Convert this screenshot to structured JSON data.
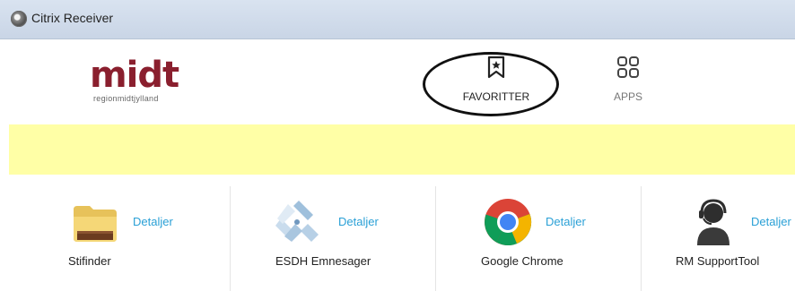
{
  "window": {
    "title": "Citrix Receiver"
  },
  "header": {
    "logo_text": "midt",
    "logo_subtext": "regionmidtjylland",
    "tabs": [
      {
        "label": "FAVORITTER",
        "icon": "bookmark-star-icon",
        "selected": true
      },
      {
        "label": "APPS",
        "icon": "apps-grid-icon",
        "selected": false
      }
    ]
  },
  "banner": {
    "color": "#ffffa6"
  },
  "apps": [
    {
      "name": "Stifinder",
      "details_label": "Detaljer",
      "icon": "folder-icon"
    },
    {
      "name": "ESDH Emnesager",
      "details_label": "Detaljer",
      "icon": "esdh-icon"
    },
    {
      "name": "Google Chrome",
      "details_label": "Detaljer",
      "icon": "chrome-icon"
    },
    {
      "name": "RM SupportTool",
      "details_label": "Detaljer",
      "icon": "support-person-icon"
    }
  ],
  "colors": {
    "accent_link": "#2aa0d6",
    "logo": "#8a1f2e"
  }
}
